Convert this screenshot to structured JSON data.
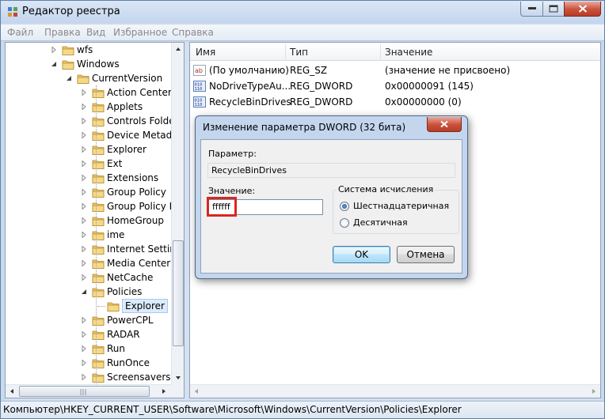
{
  "window": {
    "title": "Редактор реестра"
  },
  "menu": [
    "Файл",
    "Правка",
    "Вид",
    "Избранное",
    "Справка"
  ],
  "tree": {
    "items": [
      {
        "label": "wfs",
        "expander": "collapsed"
      },
      {
        "label": "Windows",
        "expander": "expanded"
      },
      {
        "label": "CurrentVersion",
        "expander": "expanded"
      },
      {
        "label": "Action Center",
        "expander": "collapsed"
      },
      {
        "label": "Applets",
        "expander": "collapsed"
      },
      {
        "label": "Controls Folder",
        "expander": "collapsed"
      },
      {
        "label": "Device Metadat",
        "expander": "collapsed"
      },
      {
        "label": "Explorer",
        "expander": "collapsed"
      },
      {
        "label": "Ext",
        "expander": "collapsed"
      },
      {
        "label": "Extensions",
        "expander": "collapsed"
      },
      {
        "label": "Group Policy",
        "expander": "collapsed"
      },
      {
        "label": "Group Policy Ec",
        "expander": "collapsed"
      },
      {
        "label": "HomeGroup",
        "expander": "collapsed"
      },
      {
        "label": "ime",
        "expander": "collapsed"
      },
      {
        "label": "Internet Setting",
        "expander": "collapsed"
      },
      {
        "label": "Media Center",
        "expander": "collapsed"
      },
      {
        "label": "NetCache",
        "expander": "collapsed"
      },
      {
        "label": "Policies",
        "expander": "expanded"
      },
      {
        "label": "Explorer",
        "expander": "none",
        "selected": true
      },
      {
        "label": "PowerCPL",
        "expander": "collapsed"
      },
      {
        "label": "RADAR",
        "expander": "collapsed"
      },
      {
        "label": "Run",
        "expander": "collapsed"
      },
      {
        "label": "RunOnce",
        "expander": "collapsed"
      },
      {
        "label": "Screensavers",
        "expander": "collapsed"
      }
    ]
  },
  "values": {
    "headers": {
      "name": "Имя",
      "type": "Тип",
      "data": "Значение"
    },
    "rows": [
      {
        "icon": "string-value-icon",
        "name": "(По умолчанию)",
        "type": "REG_SZ",
        "data": "(значение не присвоено)"
      },
      {
        "icon": "binary-value-icon",
        "name": "NoDriveTypeAu...",
        "type": "REG_DWORD",
        "data": "0x00000091 (145)"
      },
      {
        "icon": "binary-value-icon",
        "name": "RecycleBinDrives",
        "type": "REG_DWORD",
        "data": "0x00000000 (0)"
      }
    ]
  },
  "status": {
    "path": "Компьютер\\HKEY_CURRENT_USER\\Software\\Microsoft\\Windows\\CurrentVersion\\Policies\\Explorer"
  },
  "dialog": {
    "title": "Изменение параметра DWORD (32 бита)",
    "param_label": "Параметр:",
    "param_value": "RecycleBinDrives",
    "value_label": "Значение:",
    "value_input": "ffffff",
    "radix_group_title": "Система исчисления",
    "radix_hex": "Шестнадцатеричная",
    "radix_dec": "Десятичная",
    "radix_selected": "hex",
    "ok": "OK",
    "cancel": "Отмена"
  },
  "colors": {
    "highlight_box": "#d9271e",
    "selection": "#dcebfc"
  }
}
